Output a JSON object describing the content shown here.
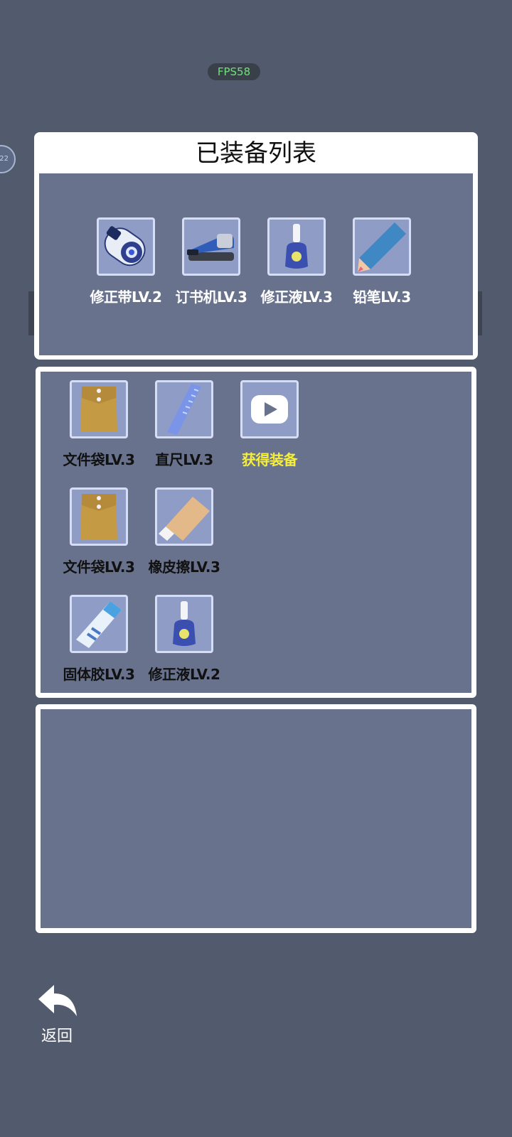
{
  "fps_label": "FPS58",
  "side_badge": "22",
  "equipped": {
    "title": "已装备列表",
    "items": [
      {
        "label": "修正带LV.2",
        "icon": "correction-tape-icon"
      },
      {
        "label": "订书机LV.3",
        "icon": "stapler-icon"
      },
      {
        "label": "修正液LV.3",
        "icon": "correction-fluid-icon"
      },
      {
        "label": "铅笔LV.3",
        "icon": "pencil-icon"
      }
    ]
  },
  "inventory": {
    "items": [
      {
        "label": "文件袋LV.3",
        "icon": "envelope-bag-icon"
      },
      {
        "label": "直尺LV.3",
        "icon": "ruler-icon"
      },
      {
        "label": "获得装备",
        "icon": "video-play-icon"
      },
      {
        "label": "文件袋LV.3",
        "icon": "envelope-bag-icon"
      },
      {
        "label": "橡皮擦LV.3",
        "icon": "eraser-icon"
      },
      {
        "label": "固体胶LV.3",
        "icon": "glue-stick-icon"
      },
      {
        "label": "修正液LV.2",
        "icon": "correction-fluid-icon"
      }
    ]
  },
  "back_label": "返回",
  "colors": {
    "background": "#525a6d",
    "panel": "#68728d",
    "slot": "#8e9cc6",
    "highlight_text": "#f5ee3a",
    "fps_text": "#6fe07a"
  }
}
